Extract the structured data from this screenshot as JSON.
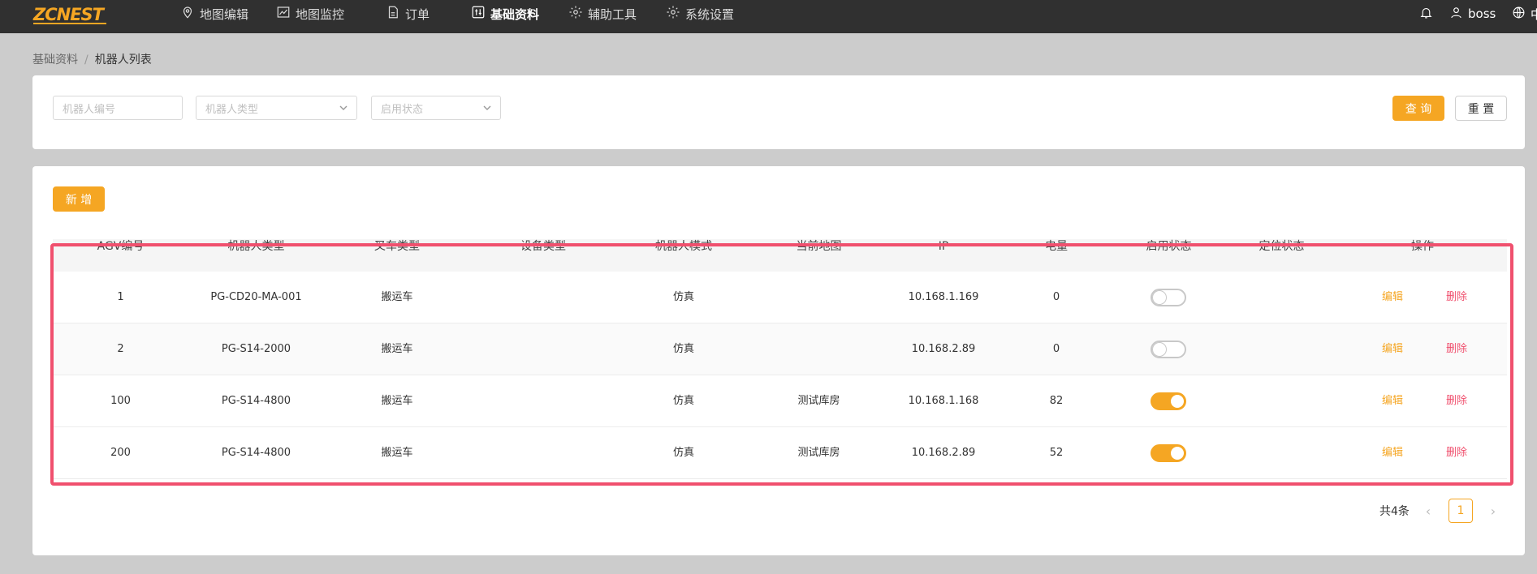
{
  "topbar": {
    "logo": "ZCNEST",
    "nav": [
      {
        "label": "地图编辑",
        "icon": "map-pin-icon"
      },
      {
        "label": "地图监控",
        "icon": "line-chart-icon"
      },
      {
        "label": "订单",
        "icon": "document-icon"
      },
      {
        "label": "基础资料",
        "icon": "sliders-icon",
        "active": true
      },
      {
        "label": "辅助工具",
        "icon": "gear-icon"
      },
      {
        "label": "系统设置",
        "icon": "gear-icon"
      }
    ],
    "user": "boss",
    "lang": "中"
  },
  "breadcrumb": {
    "parent": "基础资料",
    "separator": "/",
    "current": "机器人列表"
  },
  "filters": {
    "robot_id_placeholder": "机器人编号",
    "robot_type_placeholder": "机器人类型",
    "enable_status_placeholder": "启用状态",
    "query_label": "查 询",
    "reset_label": "重 置"
  },
  "toolbar": {
    "add_label": "新 增"
  },
  "table": {
    "columns": [
      "AGV编号",
      "机器人类型",
      "叉车类型",
      "设备类型",
      "机器人模式",
      "当前地图",
      "IP",
      "电量",
      "启用状态",
      "定位状态",
      "操作"
    ],
    "rows": [
      {
        "agv": "1",
        "robot_type": "PG-CD20-MA-001",
        "fork_type": "搬运车",
        "device_type": "",
        "mode": "仿真",
        "map": "",
        "ip": "10.168.1.169",
        "battery": "0",
        "enabled": false,
        "location": "",
        "edit": "编辑",
        "delete": "删除"
      },
      {
        "agv": "2",
        "robot_type": "PG-S14-2000",
        "fork_type": "搬运车",
        "device_type": "",
        "mode": "仿真",
        "map": "",
        "ip": "10.168.2.89",
        "battery": "0",
        "enabled": false,
        "location": "",
        "edit": "编辑",
        "delete": "删除"
      },
      {
        "agv": "100",
        "robot_type": "PG-S14-4800",
        "fork_type": "搬运车",
        "device_type": "",
        "mode": "仿真",
        "map": "测试库房",
        "ip": "10.168.1.168",
        "battery": "82",
        "enabled": true,
        "location": "",
        "edit": "编辑",
        "delete": "删除"
      },
      {
        "agv": "200",
        "robot_type": "PG-S14-4800",
        "fork_type": "搬运车",
        "device_type": "",
        "mode": "仿真",
        "map": "测试库房",
        "ip": "10.168.2.89",
        "battery": "52",
        "enabled": true,
        "location": "",
        "edit": "编辑",
        "delete": "删除"
      }
    ]
  },
  "pagination": {
    "total_text": "共4条",
    "current_page": "1"
  },
  "colors": {
    "accent": "#f5a623",
    "danger": "#f0506e",
    "topbar": "#303030"
  }
}
